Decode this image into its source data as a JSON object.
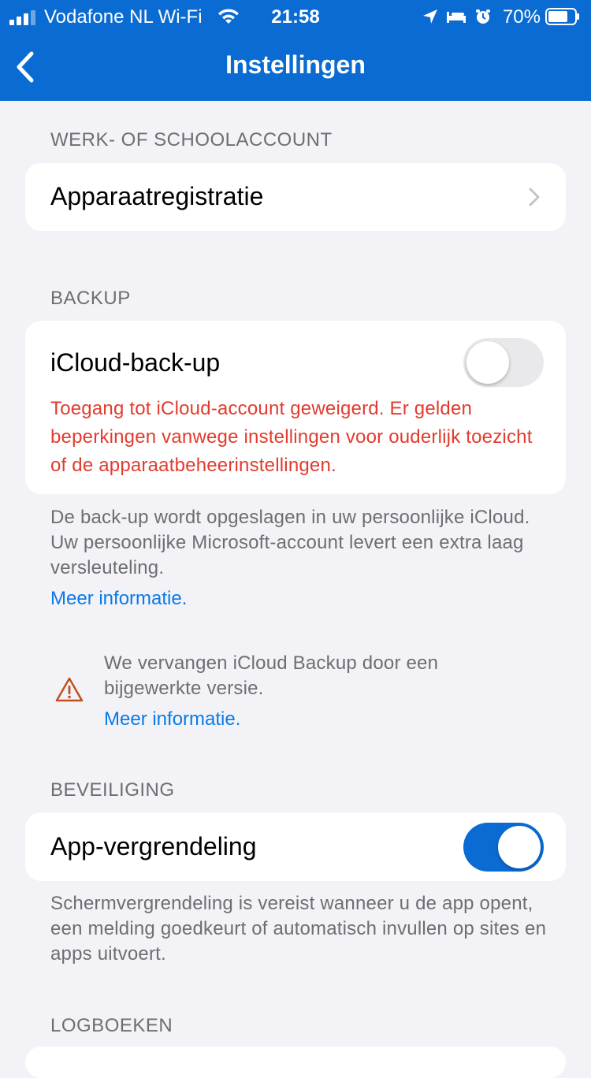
{
  "status_bar": {
    "carrier": "Vodafone NL Wi-Fi",
    "time": "21:58",
    "battery_percent": "70%",
    "signal_bars": 3,
    "icons": [
      "location-icon",
      "bed-icon",
      "alarm-icon",
      "battery-icon"
    ]
  },
  "nav": {
    "title": "Instellingen",
    "back_icon": "chevron-left-icon"
  },
  "sections": {
    "work_account": {
      "header": "WERK- OF SCHOOLACCOUNT",
      "device_registration_label": "Apparaatregistratie"
    },
    "backup": {
      "header": "BACKUP",
      "icloud_label": "iCloud-back-up",
      "icloud_enabled": false,
      "error_text": "Toegang tot iCloud-account geweigerd. Er gelden beperkingen vanwege instellingen voor ouderlijk toezicht of de apparaatbeheerinstellingen.",
      "footnote": "De back-up wordt opgeslagen in uw persoonlijke iCloud. Uw persoonlijke Microsoft-account levert een extra laag versleuteling.",
      "more_info_link": "Meer informatie.",
      "warning_text": "We vervangen iCloud Backup door een bijgewerkte versie.",
      "warning_link": "Meer informatie."
    },
    "security": {
      "header": "BEVEILIGING",
      "app_lock_label": "App-vergrendeling",
      "app_lock_enabled": true,
      "footnote": "Schermvergrendeling is vereist wanneer u de app opent, een melding goedkeurt of automatisch invullen op sites en apps uitvoert."
    },
    "logs": {
      "header": "LOGBOEKEN"
    }
  },
  "colors": {
    "accent": "#0a6cd2",
    "link": "#0a7ae6",
    "error": "#e23b2e",
    "background": "#f2f2f7",
    "warning": "#c0511d"
  }
}
